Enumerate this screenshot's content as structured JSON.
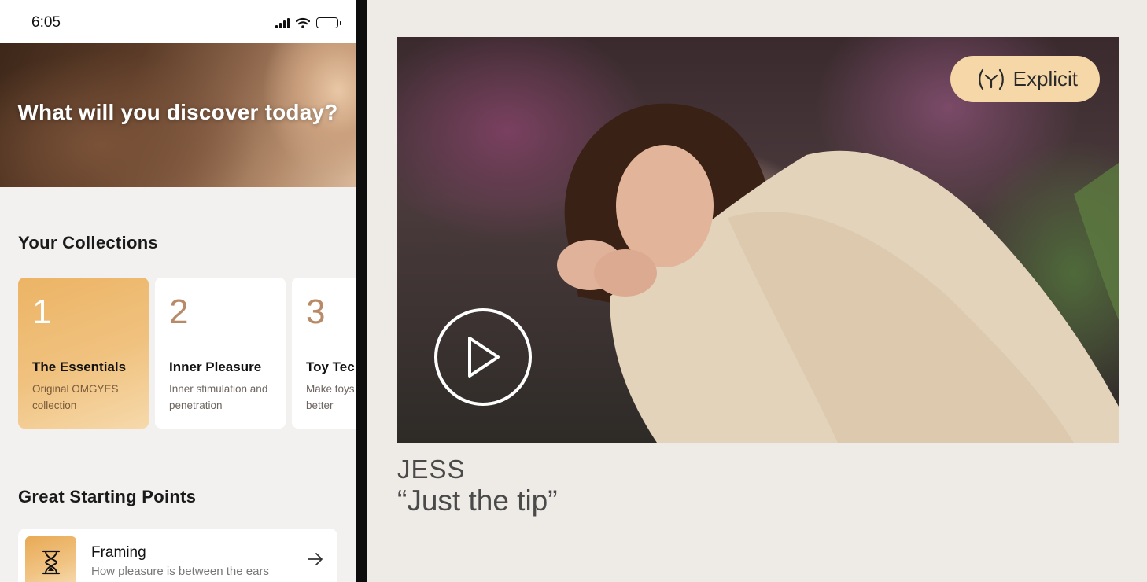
{
  "status_bar": {
    "time": "6:05"
  },
  "hero": {
    "title": "What will you discover today?"
  },
  "collections": {
    "title": "Your Collections",
    "cards": [
      {
        "number": "1",
        "title": "The Essentials",
        "description": "Original OMGYES collection",
        "selected": true
      },
      {
        "number": "2",
        "title": "Inner Pleasure",
        "description": "Inner stimulation and penetration",
        "selected": false
      },
      {
        "number": "3",
        "title": "Toy Tec",
        "description": "Make toys better",
        "selected": false
      }
    ]
  },
  "starting_points": {
    "title": "Great Starting Points",
    "items": [
      {
        "title": "Framing",
        "description": "How pleasure is between the ears",
        "icon": "hourglass-icon"
      }
    ]
  },
  "video": {
    "badge_label": "Explicit",
    "badge_icon": "explicit-icon",
    "play_icon": "play-icon",
    "name": "JESS",
    "quote": "“Just the tip”"
  },
  "colors": {
    "accent": "#f0c27f",
    "badge": "#f6d8a8",
    "card_number": "#b98a68",
    "panel_bg": "#eeeae6"
  }
}
